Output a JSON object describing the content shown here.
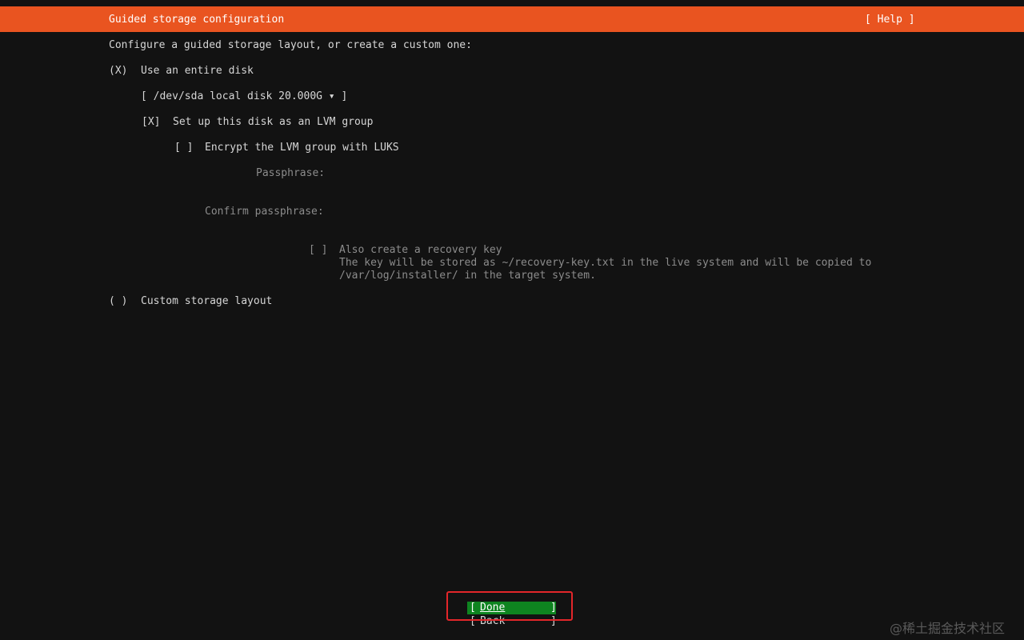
{
  "header": {
    "title": "Guided storage configuration",
    "help": "[ Help ]"
  },
  "intro": "Configure a guided storage layout, or create a custom one:",
  "options": {
    "entire_disk": {
      "marker": "(X)",
      "label": "Use an entire disk"
    },
    "disk_select": {
      "value": "[ /dev/sda local disk 20.000G ▾ ]"
    },
    "lvm": {
      "marker": "[X]",
      "label": "Set up this disk as an LVM group"
    },
    "luks": {
      "marker": "[ ]",
      "label": "Encrypt the LVM group with LUKS"
    },
    "passphrase": {
      "label": "Passphrase:"
    },
    "confirm_passphrase": {
      "label": "Confirm passphrase:"
    },
    "recovery": {
      "marker": "[ ]",
      "label": "Also create a recovery key",
      "desc_line1": "The key will be stored as ~/recovery-key.txt in the live system and will be copied to",
      "desc_line2": "/var/log/installer/ in the target system."
    },
    "custom": {
      "marker": "( )",
      "label": "Custom storage layout"
    }
  },
  "buttons": {
    "done_open": "[",
    "done_label": "Done",
    "done_close": "]",
    "back_open": "[",
    "back_label": "Back",
    "back_close": "]"
  },
  "watermark": "@稀土掘金技术社区",
  "colors": {
    "header_bg": "#e95420",
    "done_bg": "#0e8420",
    "highlight_border": "#e3262a"
  }
}
